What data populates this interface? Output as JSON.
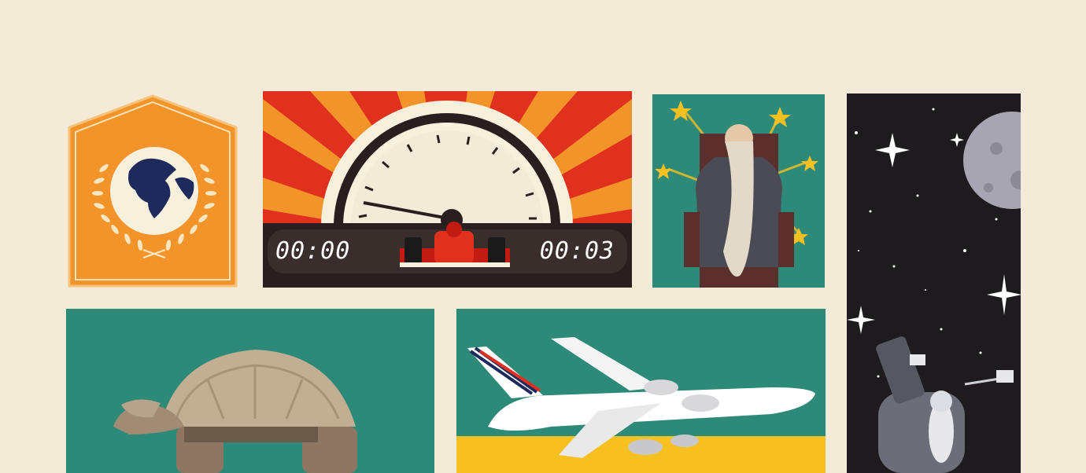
{
  "speedometer": {
    "timer_start": "00:00",
    "timer_end": "00:03"
  },
  "colors": {
    "background": "#f3ebd8",
    "orange": "#f2942a",
    "teal": "#2e8a78",
    "red": "#e0311f",
    "dark": "#2a1f1e",
    "space": "#1d1b1e",
    "yellow": "#f6c021",
    "globe_navy": "#1f2a5c"
  },
  "icons": [
    "globe-laurel-badge",
    "speedometer-race-car",
    "bearded-man-on-throne",
    "astronaut-with-telescope",
    "giant-tortoise",
    "airliner"
  ]
}
